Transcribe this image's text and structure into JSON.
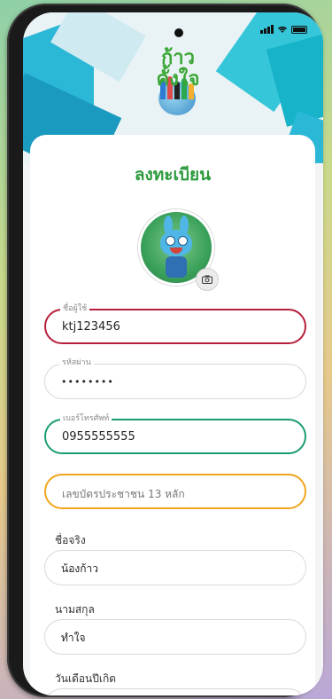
{
  "app": {
    "logo_text": "ก้าว\nคั้งใจ",
    "title": "ลงทะเบียน"
  },
  "form": {
    "username": {
      "label": "ชื่อผู้ใช้",
      "value": "ktj123456"
    },
    "password": {
      "label": "รหัสผ่าน",
      "value": "••••••••"
    },
    "phone": {
      "label": "เบอร์โทรศัพท์",
      "value": "0955555555"
    },
    "id_card": {
      "placeholder": "เลขบัตรประชาชน 13 หลัก"
    },
    "first_name": {
      "label": "ชื่อจริง",
      "value": "น้องก้าว"
    },
    "last_name": {
      "label": "นามสกุล",
      "value": "ทำใจ"
    },
    "birthdate": {
      "label": "วันเดือนปีเกิด"
    }
  },
  "colors": {
    "brand_green": "#2e9b3f",
    "highlight_red": "#b61f3c",
    "highlight_green": "#1b9c74",
    "highlight_orange": "#f0a51e"
  },
  "icons": {
    "camera": "camera-icon",
    "signal": "signal-icon",
    "wifi": "wifi-icon",
    "battery": "battery-icon"
  }
}
